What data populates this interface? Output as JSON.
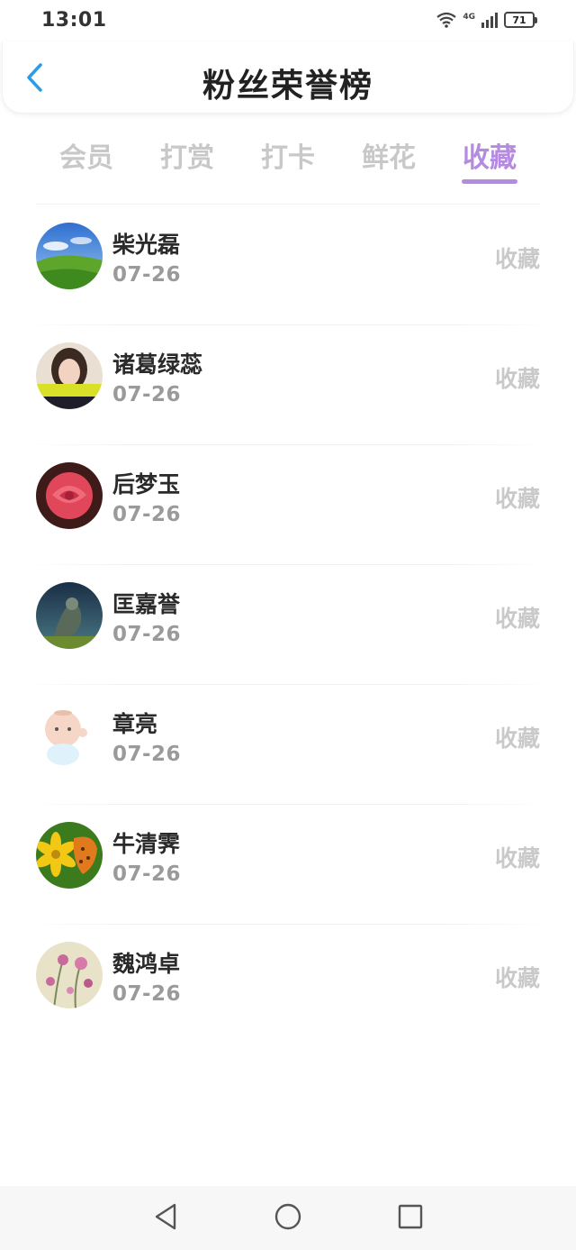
{
  "status_bar": {
    "time": "13:01",
    "network": "4G",
    "battery": "71"
  },
  "header": {
    "title": "粉丝荣誉榜",
    "back_icon": "chevron-left-icon",
    "accent_color": "#2c9be8"
  },
  "tabs": [
    {
      "label": "会员",
      "active": false
    },
    {
      "label": "打赏",
      "active": false
    },
    {
      "label": "打卡",
      "active": false
    },
    {
      "label": "鲜花",
      "active": false
    },
    {
      "label": "收藏",
      "active": true
    }
  ],
  "tab_active_color": "#b58be0",
  "list": [
    {
      "name": "柴光磊",
      "date": "07-26",
      "action": "收藏"
    },
    {
      "name": "诸葛绿蕊",
      "date": "07-26",
      "action": "收藏"
    },
    {
      "name": "后梦玉",
      "date": "07-26",
      "action": "收藏"
    },
    {
      "name": "匡嘉誉",
      "date": "07-26",
      "action": "收藏"
    },
    {
      "name": "章亮",
      "date": "07-26",
      "action": "收藏"
    },
    {
      "name": "牛清霁",
      "date": "07-26",
      "action": "收藏"
    },
    {
      "name": "魏鸿卓",
      "date": "07-26",
      "action": "收藏"
    }
  ],
  "nav_bar": {
    "back_icon": "triangle-back-icon",
    "home_icon": "circle-home-icon",
    "recents_icon": "square-recents-icon"
  }
}
